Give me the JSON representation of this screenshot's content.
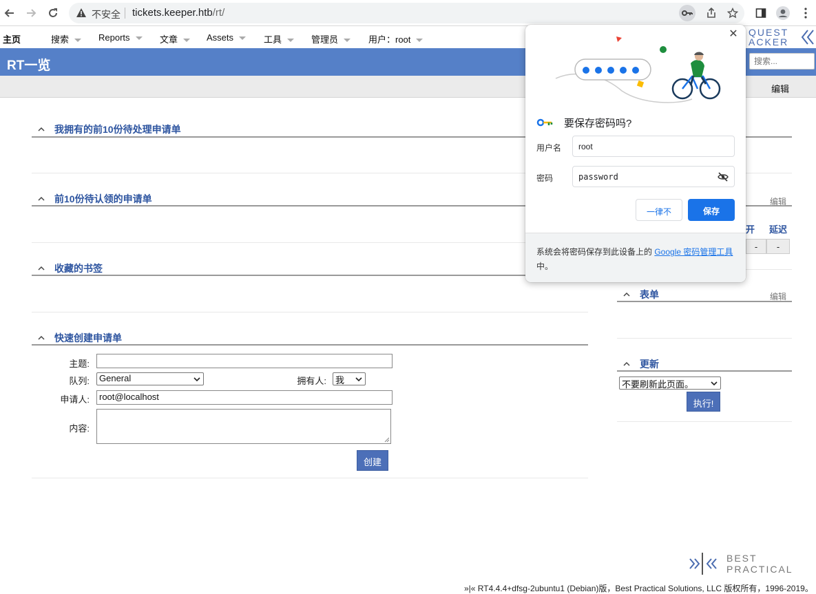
{
  "browser": {
    "insecure_label": "不安全",
    "url_host": "tickets.keeper.htb",
    "url_path": "/rt/"
  },
  "nav": {
    "items": [
      "主页",
      "搜索",
      "Reports",
      "文章",
      "Assets",
      "工具",
      "管理员",
      "用户：root"
    ]
  },
  "logo_text": "QUEST\nACKER",
  "page": {
    "title": "RT一览",
    "search_placeholder": "搜索...",
    "edit_label": "编辑"
  },
  "portlets": {
    "owned": {
      "title": "我拥有的前10份待处理申请单"
    },
    "unclaimed": {
      "title": "前10份待认领的申请单"
    },
    "bookmarks": {
      "title": "收藏的书签"
    },
    "quick_create": {
      "title": "快速创建申请单",
      "subject_label": "主题:",
      "subject_value": "",
      "queue_label": "队列:",
      "queue_value": "General",
      "owner_label": "拥有人:",
      "owner_value": "我",
      "requestor_label": "申请人:",
      "requestor_value": "root@localhost",
      "content_label": "内容:",
      "create_button": "创建"
    },
    "queue_list": {
      "edit_label": "编辑",
      "col_open_fragment": "开",
      "col_stalled": "延迟",
      "cells": [
        "-",
        "-"
      ]
    },
    "dashboards": {
      "title": "表单",
      "edit_label": "编辑"
    },
    "refresh": {
      "title": "更新",
      "select_value": "不要刷新此页面。",
      "go_button": "执行!"
    }
  },
  "footer": {
    "text": "»|« RT4.4.4+dfsg-2ubuntu1 (Debian)版，Best Practical Solutions, LLC 版权所有，1996-2019。",
    "logo_line1": "BEST",
    "logo_line2": "PRACTICAL"
  },
  "password_popup": {
    "heading": "要保存密码吗?",
    "username_label": "用户名",
    "username_value": "root",
    "password_label": "密码",
    "password_value": "password",
    "never_button": "一律不",
    "save_button": "保存",
    "footer_text": "系统会将密码保存到此设备上的 ",
    "footer_link": "Google 密码管理工具",
    "footer_tail": "中。"
  },
  "colors": {
    "title_bar": "#5580c8",
    "portlet_title": "#2e55a0",
    "google_blue": "#1a73e8",
    "rt_button": "#4c6fb8"
  }
}
